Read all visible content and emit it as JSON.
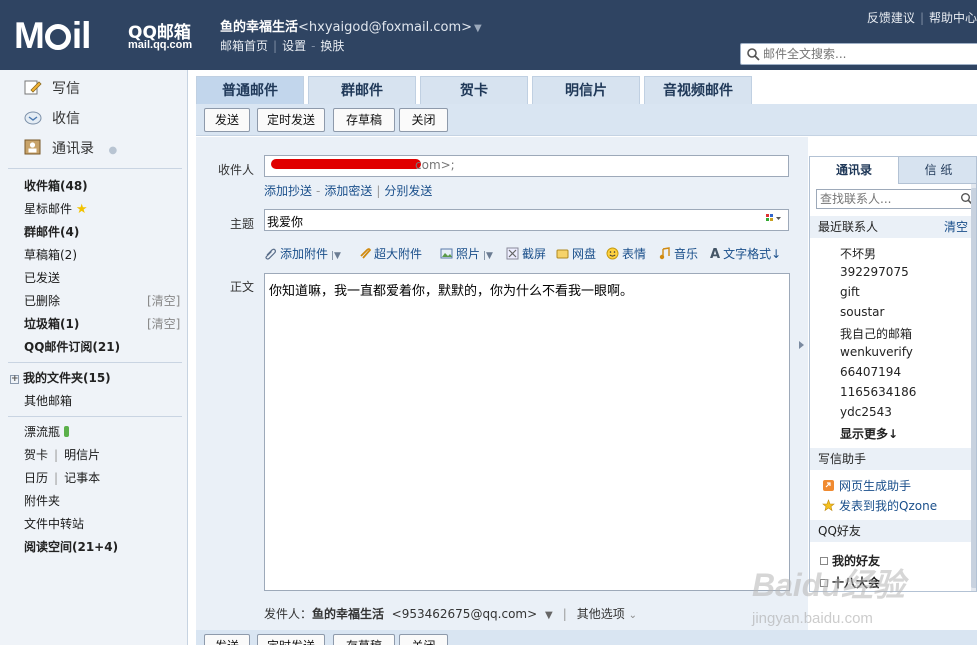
{
  "header": {
    "logo_qq": "QQ邮箱",
    "logo_domain": "mail.qq.com",
    "user_name": "鱼的幸福生活",
    "user_email": "<hxyaigod@foxmail.com>",
    "links": [
      "邮箱首页",
      "设置",
      "换肤"
    ],
    "top_right": [
      "反馈建议",
      "帮助中心"
    ],
    "search_placeholder": "邮件全文搜索..."
  },
  "sidebar": {
    "primary": [
      {
        "label": "写信",
        "icon": "pencil-icon"
      },
      {
        "label": "收信",
        "icon": "inbox-icon"
      },
      {
        "label": "通讯录",
        "icon": "contacts-icon"
      }
    ],
    "folders": [
      {
        "label": "收件箱(48)",
        "bold": true
      },
      {
        "label": "星标邮件",
        "bold": false
      },
      {
        "label": "群邮件(4)",
        "bold": true
      },
      {
        "label": "草稿箱(2)",
        "bold": false
      },
      {
        "label": "已发送",
        "bold": false
      },
      {
        "label": "已删除",
        "bold": false,
        "clear": "[清空]"
      },
      {
        "label": "垃圾箱(1)",
        "bold": true,
        "clear": "[清空]"
      },
      {
        "label": "QQ邮件订阅(21)",
        "bold": true
      }
    ],
    "my_folders": "我的文件夹(15)",
    "other_mailbox": "其他邮箱",
    "apps": {
      "drift_bottle": "漂流瓶",
      "card": "贺卡",
      "postcard": "明信片",
      "calendar": "日历",
      "notes": "记事本",
      "attachments": "附件夹",
      "transfer": "文件中转站",
      "reading": "阅读空间(21+4)"
    }
  },
  "tabs": [
    "普通邮件",
    "群邮件",
    "贺卡",
    "明信片",
    "音视频邮件"
  ],
  "toolbar": {
    "send": "发送",
    "schedule": "定时发送",
    "draft": "存草稿",
    "close": "关闭"
  },
  "compose": {
    "to_label": "收件人",
    "to_tail": "com>;",
    "cc_links": [
      "添加抄送",
      "添加密送",
      "分别发送"
    ],
    "subject_label": "主题",
    "subject_value": "我爱你",
    "attach": {
      "add_attachment": "添加附件",
      "big_attachment": "超大附件",
      "photo": "照片",
      "screenshot": "截屏",
      "disk": "网盘",
      "emoji": "表情",
      "music": "音乐",
      "text_format": "文字格式↓"
    },
    "body_label": "正文",
    "body_text": "你知道嘛，我一直都爱着你，默默的，你为什么不看我一眼啊。",
    "sender_label": "发件人：",
    "sender_name": "鱼的幸福生活",
    "sender_email": "<953462675@qq.com>",
    "other_options": "其他选项"
  },
  "right_panel": {
    "tab_contacts": "通讯录",
    "tab_paper": "信 纸",
    "search_placeholder": "查找联系人...",
    "recent_title": "最近联系人",
    "recent_clear": "清空",
    "contacts": [
      "不坏男",
      "392297075",
      "gift",
      "soustar",
      "我自己的邮箱",
      "wenkuverify",
      "66407194",
      "1165634186",
      "ydc2543"
    ],
    "show_more": "显示更多↓",
    "helper_title": "写信助手",
    "helpers": [
      "网页生成助手",
      "发表到我的Qzone"
    ],
    "qq_title": "QQ好友",
    "qq_groups": [
      "我的好友",
      "十八大会"
    ]
  },
  "watermark": {
    "brand": "Baidu经验",
    "url": "jingyan.baidu.com"
  }
}
